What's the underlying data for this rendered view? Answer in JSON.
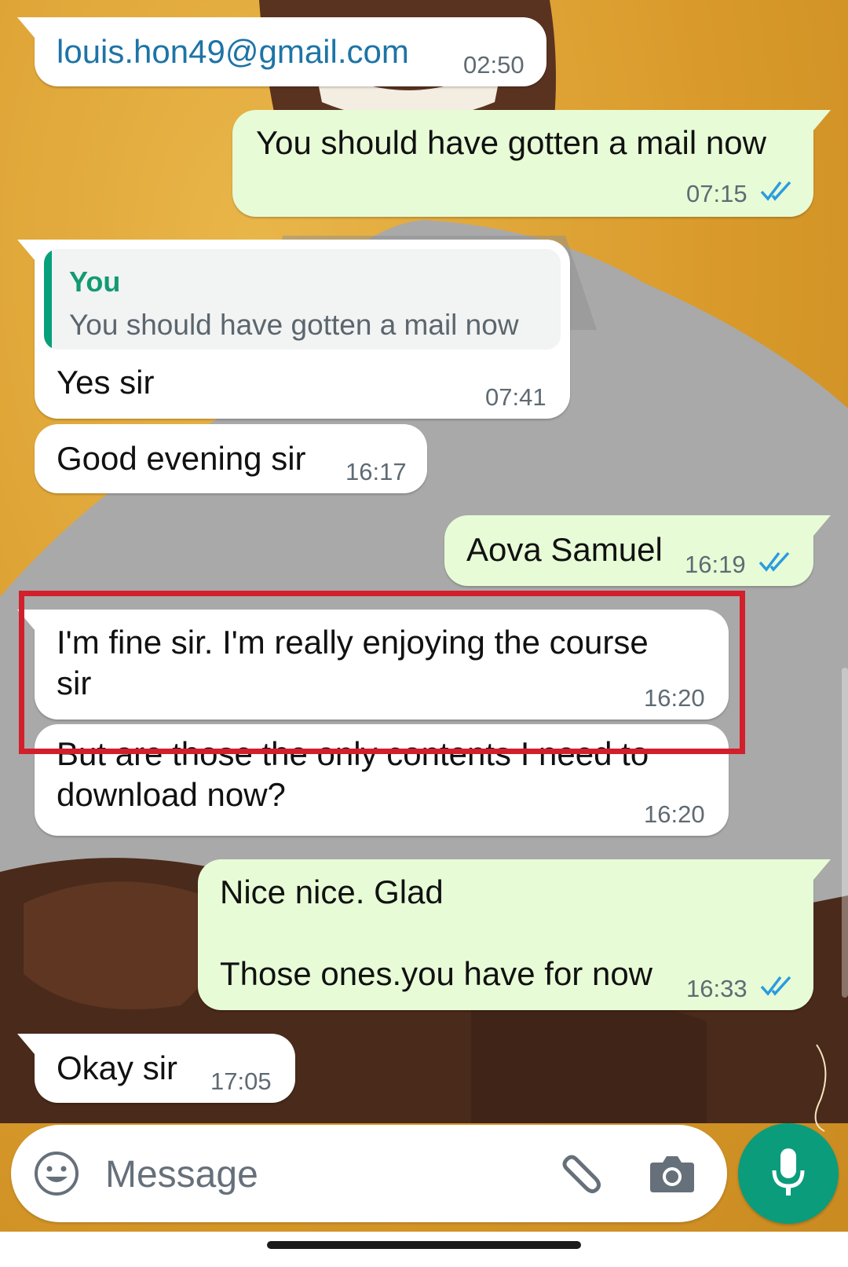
{
  "colors": {
    "incoming_bubble": "#ffffff",
    "outgoing_bubble": "#e7fcd6",
    "accent_green": "#0b9c7c",
    "read_ticks": "#2a9be0",
    "highlight_box": "#d21f2b"
  },
  "messages": [
    {
      "direction": "incoming",
      "text": "louis.hon49@gmail.com",
      "time": "02:50",
      "is_link": true
    },
    {
      "direction": "outgoing",
      "text": "You should have gotten a mail now",
      "time": "07:15",
      "status": "read"
    },
    {
      "direction": "incoming",
      "quoted_author": "You",
      "quoted_text": "You should have gotten a mail now",
      "text": "Yes sir",
      "time": "07:41"
    },
    {
      "direction": "incoming",
      "text": "Good evening sir",
      "time": "16:17"
    },
    {
      "direction": "outgoing",
      "text": "Aova Samuel",
      "time": "16:19",
      "status": "read"
    },
    {
      "direction": "incoming",
      "text": "I'm fine sir. I'm really enjoying the course\nsir",
      "time": "16:20",
      "highlighted": true
    },
    {
      "direction": "incoming",
      "text": "But are those the only contents I need to\ndownload now?",
      "time": "16:20"
    },
    {
      "direction": "outgoing",
      "text": "Nice nice. Glad\n\nThose ones.you have for now",
      "time": "16:33",
      "status": "read"
    },
    {
      "direction": "incoming",
      "text": "Okay sir",
      "time": "17:05"
    }
  ],
  "composer": {
    "placeholder": "Message",
    "emoji_icon": "smiley-icon",
    "attach_icon": "paperclip-icon",
    "camera_icon": "camera-icon",
    "send_icon": "microphone-icon"
  }
}
